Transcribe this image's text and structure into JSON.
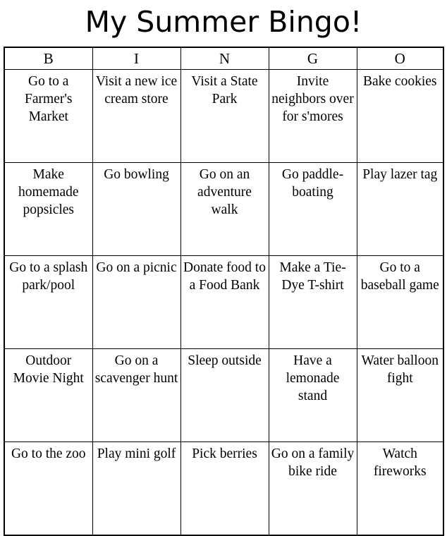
{
  "page": {
    "title": "My Summer Bingo!",
    "background_color": "#ffffff",
    "text_color": "#000000",
    "border_color": "#000000"
  },
  "card": {
    "columns": [
      "B",
      "I",
      "N",
      "G",
      "O"
    ],
    "rows": [
      [
        "Go to a Farmer's Market",
        "Visit a new ice cream store",
        "Visit a State Park",
        "Invite neighbors over for s'mores",
        "Bake cookies"
      ],
      [
        "Make homemade popsicles",
        "Go bowling",
        "Go on an adventure walk",
        "Go paddle-boating",
        "Play lazer tag"
      ],
      [
        "Go to a splash park/pool",
        "Go on a picnic",
        "Donate food to a Food Bank",
        "Make a Tie-Dye T-shirt",
        "Go to a baseball game"
      ],
      [
        "Outdoor Movie Night",
        "Go on a scavenger hunt",
        "Sleep outside",
        "Have a lemonade stand",
        "Water balloon fight"
      ],
      [
        "Go to the zoo",
        "Play mini golf",
        "Pick berries",
        "Go on a family bike ride",
        "Watch fireworks"
      ]
    ]
  }
}
